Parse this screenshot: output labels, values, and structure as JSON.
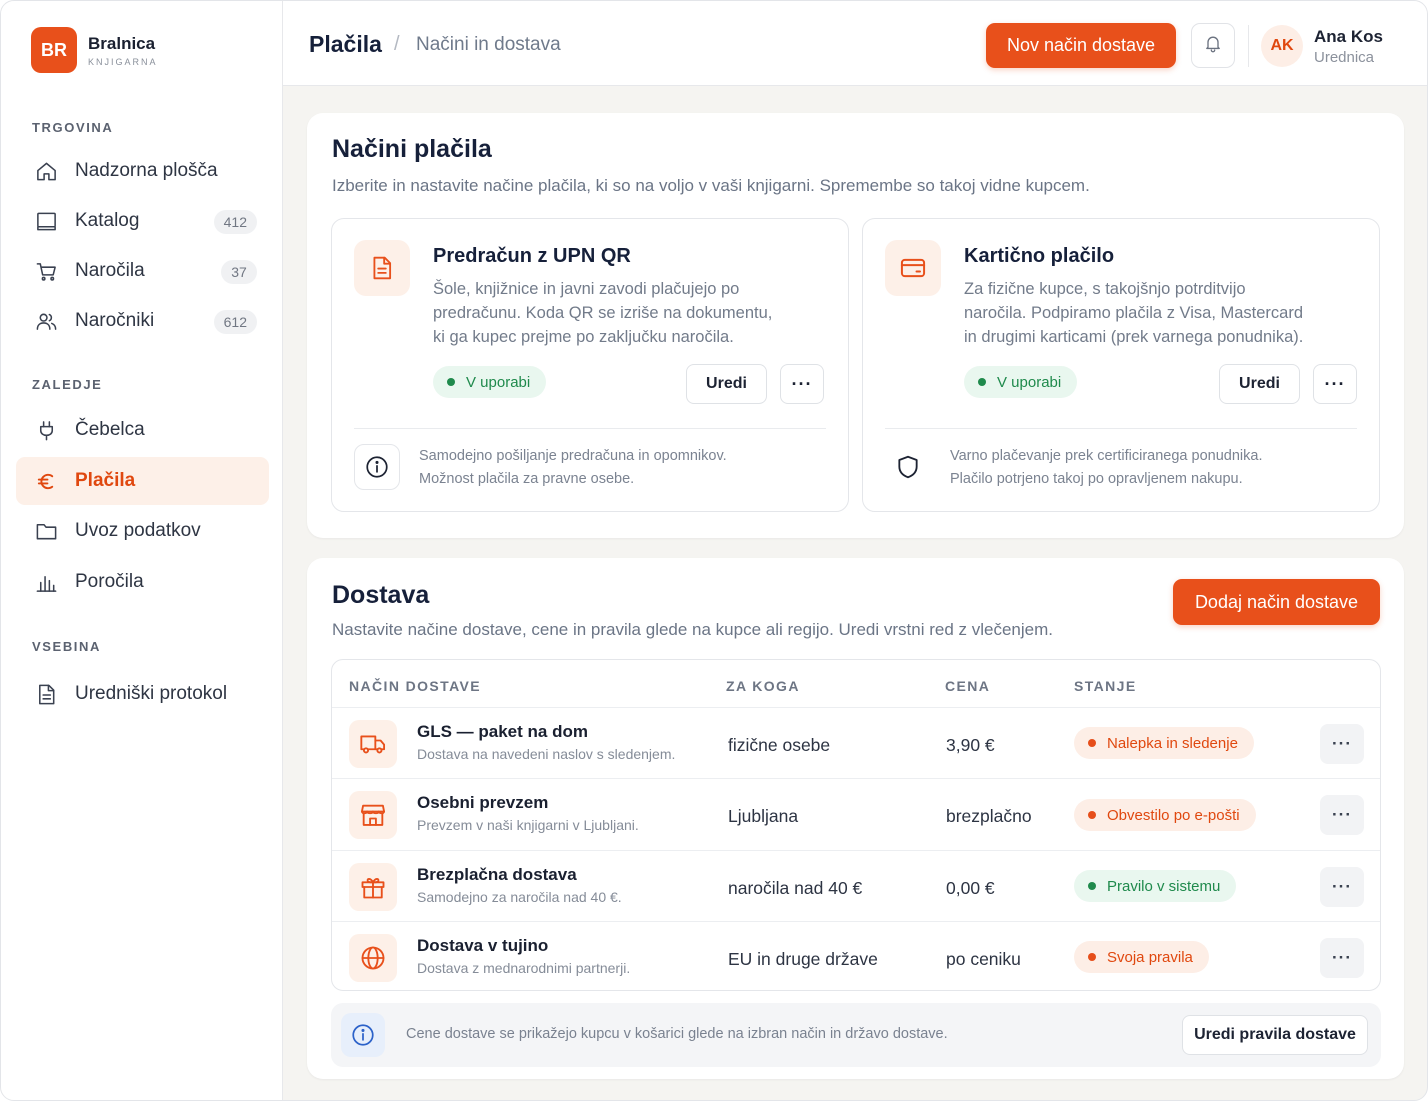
{
  "brand": {
    "logo": "BR",
    "name": "Bralnica",
    "sub": "KNJIGARNA"
  },
  "sidebar": {
    "sections": [
      {
        "title": "TRGOVINA"
      },
      {
        "title": "ZALEDJE"
      },
      {
        "title": "VSEBINA"
      }
    ],
    "items": [
      {
        "label": "Nadzorna plošča",
        "icon": "home-icon"
      },
      {
        "label": "Katalog",
        "badge": "412",
        "icon": "book-icon"
      },
      {
        "label": "Naročila",
        "badge": "37",
        "icon": "cart-icon"
      },
      {
        "label": "Naročniki",
        "badge": "612",
        "icon": "users-icon"
      },
      {
        "label": "Čebelca",
        "icon": "plug-icon"
      },
      {
        "label": "Plačila",
        "icon": "euro-icon",
        "active": true
      },
      {
        "label": "Uvoz podatkov",
        "icon": "folder-icon"
      },
      {
        "label": "Poročila",
        "icon": "chart-icon"
      },
      {
        "label": "Uredniški protokol",
        "icon": "document-icon"
      }
    ]
  },
  "header": {
    "title": "Plačila",
    "separator": "/",
    "subtitle": "Načini in dostava",
    "primary_button": "Nov način dostave",
    "user": {
      "initials": "AK",
      "name": "Ana Kos",
      "role": "Urednica"
    }
  },
  "payments": {
    "title": "Načini plačila",
    "description": "Izberite in nastavite načine plačila, ki so na voljo v vaši knjigarni. Spremembe so takoj vidne kupcem.",
    "cards": [
      {
        "title": "Predračun z UPN QR",
        "desc_lines": [
          "Šole, knjižnice in javni zavodi plačujejo po",
          "predračunu. Koda QR se izriše na dokumentu,",
          "ki ga kupec prejme po zaključku naročila."
        ],
        "status": "V uporabi",
        "edit_label": "Uredi",
        "more_label": "···",
        "note_lines": [
          "Samodejno pošiljanje predračuna in opomnikov.",
          "Možnost plačila za pravne osebe."
        ],
        "icon": "invoice-icon",
        "note_icon": "info-icon"
      },
      {
        "title": "Kartično plačilo",
        "desc_lines": [
          "Za fizične kupce, s takojšnjo potrditvijo",
          "naročila. Podpiramo plačila z Visa, Mastercard",
          "in drugimi karticami (prek varnega ponudnika)."
        ],
        "status": "V uporabi",
        "edit_label": "Uredi",
        "more_label": "···",
        "note_lines": [
          "Varno plačevanje prek certificiranega ponudnika.",
          "Plačilo potrjeno takoj po opravljenem nakupu."
        ],
        "icon": "credit-card-icon",
        "note_icon": "shield-icon"
      }
    ]
  },
  "shipping": {
    "title": "Dostava",
    "description": "Nastavite načine dostave, cene in pravila glede na kupce ali regijo. Uredi vrstni red z vlečenjem.",
    "add_button": "Dodaj način dostave",
    "columns": [
      "NAČIN DOSTAVE",
      "ZA KOGA",
      "CENA",
      "STANJE"
    ],
    "rows": [
      {
        "name": "GLS — paket na dom",
        "sub": "Dostava na navedeni naslov s sledenjem.",
        "who": "fizične osebe",
        "price": "3,90 €",
        "status": "Nalepka in sledenje",
        "tone": "orange",
        "icon": "truck-icon"
      },
      {
        "name": "Osebni prevzem",
        "sub": "Prevzem v naši knjigarni v Ljubljani.",
        "who": "Ljubljana",
        "price": "brezplačno",
        "status": "Obvestilo po e-pošti",
        "tone": "orange",
        "icon": "store-icon"
      },
      {
        "name": "Brezplačna dostava",
        "sub": "Samodejno za naročila nad 40 €.",
        "who": "naročila nad 40 €",
        "price": "0,00 €",
        "status": "Pravilo v sistemu",
        "tone": "green",
        "icon": "gift-icon"
      },
      {
        "name": "Dostava v tujino",
        "sub": "Dostava z mednarodnimi partnerji.",
        "who": "EU in druge države",
        "price": "po ceniku",
        "status": "Svoja pravila",
        "tone": "orange",
        "icon": "globe-icon"
      }
    ],
    "row_more": "···",
    "footer_text": "Cene dostave se prikažejo kupcu v košarici glede na izbran način in državo dostave.",
    "footer_button": "Uredi pravila dostave"
  },
  "colors": {
    "accent": "#e8501b",
    "accent_soft": "#fdf0e8",
    "green": "#1f8a4c",
    "green_soft": "#e9f7ef"
  }
}
